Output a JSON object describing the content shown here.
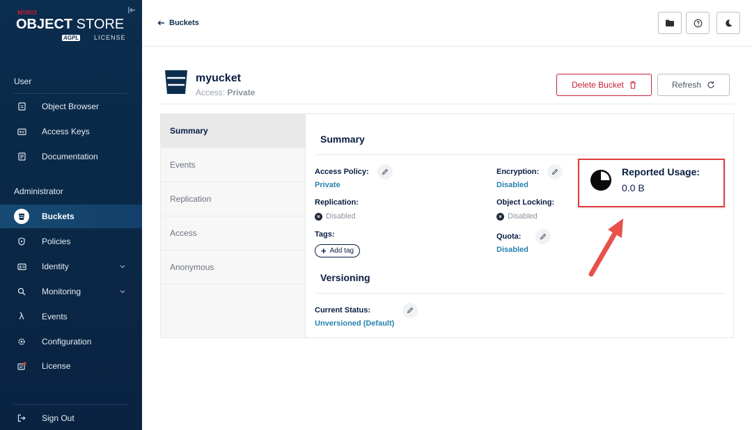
{
  "sidebar": {
    "logo": {
      "brand": "MINIO",
      "product_bold": "OBJECT",
      "product_rest": " STORE",
      "badge": "AGPL",
      "license": "LICENSE"
    },
    "user_section": "User",
    "user_items": [
      {
        "label": "Object Browser",
        "icon": "object-browser-icon"
      },
      {
        "label": "Access Keys",
        "icon": "access-keys-icon"
      },
      {
        "label": "Documentation",
        "icon": "documentation-icon"
      }
    ],
    "admin_section": "Administrator",
    "admin_items": [
      {
        "label": "Buckets",
        "icon": "buckets-icon"
      },
      {
        "label": "Policies",
        "icon": "policies-icon"
      },
      {
        "label": "Identity",
        "icon": "identity-icon"
      },
      {
        "label": "Monitoring",
        "icon": "monitoring-icon"
      },
      {
        "label": "Events",
        "icon": "lambda-icon"
      },
      {
        "label": "Configuration",
        "icon": "gear-icon"
      },
      {
        "label": "License",
        "icon": "license-icon"
      }
    ],
    "sign_out": "Sign Out"
  },
  "topbar": {
    "back_label": "Buckets"
  },
  "bucket": {
    "name": "myucket",
    "access_label": "Access:",
    "access_value": "Private",
    "delete_label": "Delete Bucket",
    "refresh_label": "Refresh"
  },
  "tabs": [
    "Summary",
    "Events",
    "Replication",
    "Access",
    "Anonymous"
  ],
  "summary": {
    "title": "Summary",
    "access_policy_label": "Access Policy:",
    "access_policy_value": "Private",
    "replication_label": "Replication:",
    "replication_value": "Disabled",
    "tags_label": "Tags:",
    "add_tag_label": "Add tag",
    "encryption_label": "Encryption:",
    "encryption_value": "Disabled",
    "object_locking_label": "Object Locking:",
    "object_locking_value": "Disabled",
    "quota_label": "Quota:",
    "quota_value": "Disabled",
    "usage_title": "Reported Usage:",
    "usage_value": "0.0 B"
  },
  "versioning": {
    "title": "Versioning",
    "status_label": "Current Status:",
    "status_value": "Unversioned (Default)"
  },
  "colors": {
    "sidebar_bg": "#0b2d4e",
    "accent_red": "#c51d3b",
    "link_blue": "#2781b0",
    "highlight_red": "#e23b3b"
  }
}
